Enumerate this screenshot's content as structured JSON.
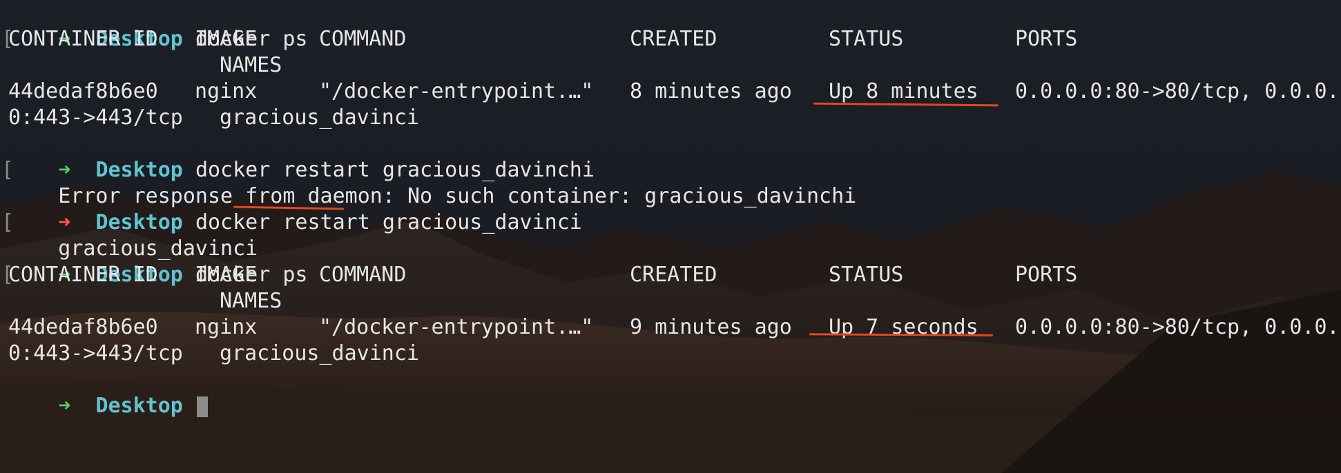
{
  "prompt": {
    "arrow": "➜",
    "dir": "Desktop"
  },
  "lines": {
    "l0_cmd": "docker ps",
    "hdr1": {
      "container_id": "CONTAINER ID",
      "image": "IMAGE",
      "command": "COMMAND",
      "created": "CREATED",
      "status": "STATUS",
      "ports": "PORTS",
      "names": "NAMES"
    },
    "row1": {
      "container_id": "44dedaf8b6e0",
      "image": "nginx",
      "command": "\"/docker-entrypoint.…\"",
      "created": "8 minutes ago",
      "status": "Up 8 minutes",
      "ports_a": "0.0.0.0:80->80/tcp, 0.0.0.",
      "ports_b": "0:443->443/tcp",
      "names": "gracious_davinci"
    },
    "l4_cmd": "docker restart gracious_davinchi",
    "l5_err": "Error response from daemon: No such container: gracious_davinchi",
    "l6_cmd": "docker restart gracious_davinci",
    "l7_out": "gracious_davinci",
    "l8_cmd": "docker ps",
    "hdr2": {
      "container_id": "CONTAINER ID",
      "image": "IMAGE",
      "command": "COMMAND",
      "created": "CREATED",
      "status": "STATUS",
      "ports": "PORTS",
      "names": "NAMES"
    },
    "row2": {
      "container_id": "44dedaf8b6e0",
      "image": "nginx",
      "command": "\"/docker-entrypoint.…\"",
      "created": "9 minutes ago",
      "status": "Up 7 seconds",
      "ports_a": "0.0.0.0:80->80/tcp, 0.0.0.",
      "ports_b": "0:443->443/tcp",
      "names": "gracious_davinci"
    }
  },
  "colors": {
    "prompt_ok": "#4fd06a",
    "prompt_err": "#ff5a3c",
    "dir": "#5fc4d2",
    "text": "#e6e6e6",
    "annotation": "#e4471f"
  }
}
